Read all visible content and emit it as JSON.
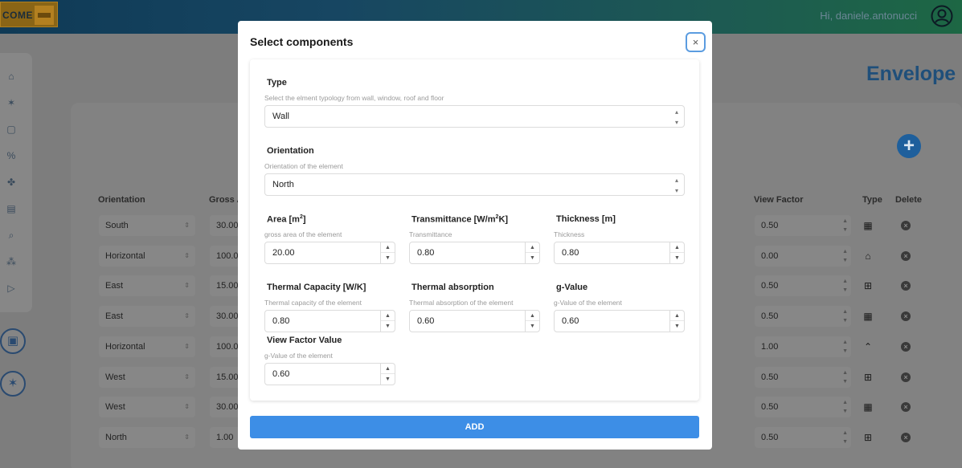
{
  "app": {
    "logo_text": "COME",
    "greeting": "Hi, daniele.antonucci",
    "page_title": "Envelope"
  },
  "table": {
    "headers": {
      "orientation": "Orientation",
      "gross_area": "Gross A",
      "view_factor": "View Factor",
      "type": "Type",
      "delete": "Delete"
    },
    "rows": [
      {
        "orientation": "South",
        "gross": "30.00",
        "view_factor": "0.50",
        "type_icon": "window-icon"
      },
      {
        "orientation": "Horizontal",
        "gross": "100.0",
        "view_factor": "0.00",
        "type_icon": "floor-icon"
      },
      {
        "orientation": "East",
        "gross": "15.00",
        "view_factor": "0.50",
        "type_icon": "window-grid-icon"
      },
      {
        "orientation": "East",
        "gross": "30.00",
        "view_factor": "0.50",
        "type_icon": "wall-icon"
      },
      {
        "orientation": "Horizontal",
        "gross": "100.0",
        "view_factor": "1.00",
        "type_icon": "roof-icon"
      },
      {
        "orientation": "West",
        "gross": "15.00",
        "view_factor": "0.50",
        "type_icon": "window-grid-icon"
      },
      {
        "orientation": "West",
        "gross": "30.00",
        "view_factor": "0.50",
        "type_icon": "wall-icon"
      },
      {
        "orientation": "North",
        "gross": "1.00",
        "view_factor": "0.50",
        "type_icon": "window-grid-icon"
      }
    ]
  },
  "modal": {
    "title": "Select components",
    "close_label": "×",
    "type": {
      "label": "Type",
      "help": "Select the elment typology from wall, window, roof and floor",
      "value": "Wall"
    },
    "orientation": {
      "label": "Orientation",
      "help": "Orientation of the element",
      "value": "North"
    },
    "area": {
      "label": "Area [m",
      "label_sup": "2",
      "label_end": "]",
      "help": "gross area of the element",
      "value": "20.00"
    },
    "transmittance": {
      "label": "Transmittance [W/m",
      "label_sup": "2",
      "label_end": "K]",
      "help": "Transmittance",
      "value": "0.80"
    },
    "thickness": {
      "label": "Thickness [m]",
      "help": "Thickness",
      "value": "0.80"
    },
    "thermal_capacity": {
      "label": "Thermal Capacity [W/K]",
      "help": "Thermal capacity of the element",
      "value": "0.80"
    },
    "thermal_absorption": {
      "label": "Thermal absorption",
      "help": "Thermal absorption of the element",
      "value": "0.60"
    },
    "g_value": {
      "label": "g-Value",
      "help": "g-Value of the element",
      "value": "0.60"
    },
    "view_factor": {
      "label": "View Factor Value",
      "help": "g-Value of the element",
      "value": "0.60"
    },
    "add_label": "ADD"
  },
  "colors": {
    "accent": "#3d8ee6",
    "overlay": "#7d7d7d",
    "title": "#1f4f7a"
  }
}
